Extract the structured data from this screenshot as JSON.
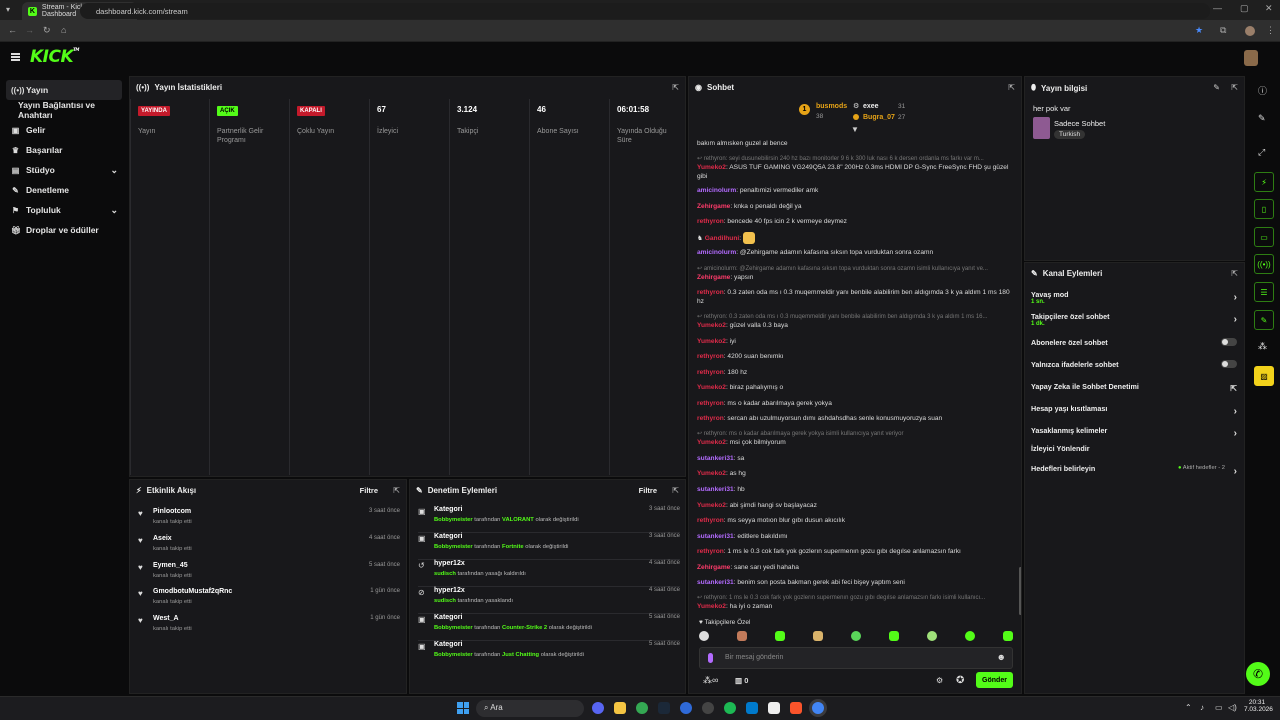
{
  "browser": {
    "tab_title": "Stream - Kick Dashboard",
    "url": "dashboard.kick.com/stream"
  },
  "app": {
    "logo": "KICK",
    "logo_tm": "TM"
  },
  "sidebar": {
    "items": [
      {
        "label": "Yayın",
        "icon": "broadcast-icon"
      },
      {
        "label": "Yayın Bağlantısı ve Anahtarı",
        "icon": ""
      },
      {
        "label": "Gelir",
        "icon": "wallet-icon"
      },
      {
        "label": "Başarılar",
        "icon": "trophy-icon"
      },
      {
        "label": "Stüdyo",
        "icon": "studio-icon"
      },
      {
        "label": "Denetleme",
        "icon": "wrench-icon"
      },
      {
        "label": "Topluluk",
        "icon": "community-icon"
      },
      {
        "label": "Droplar ve ödüller",
        "icon": "gift-icon"
      }
    ]
  },
  "stats": {
    "title": "Yayın İstatistikleri",
    "items": [
      {
        "badge": "YAYINDA",
        "badge_color": "#c41a2b",
        "label": "Yayın"
      },
      {
        "badge": "AÇIK",
        "badge_color": "#53fc18",
        "label": "Partnerlik Gelir Programı"
      },
      {
        "badge": "KAPALI",
        "badge_color": "#c41a2b",
        "label": "Çoklu Yayın"
      },
      {
        "value": "67",
        "label": "İzleyici"
      },
      {
        "value": "3.124",
        "label": "Takipçi"
      },
      {
        "value": "46",
        "label": "Abone Sayısı"
      },
      {
        "value": "06:01:58",
        "label": "Yayında Olduğu Süre"
      }
    ]
  },
  "chat": {
    "title": "Sohbet",
    "top": [
      {
        "name": "busmods",
        "count": "38"
      },
      {
        "name": "exee",
        "count": "31"
      },
      {
        "name": "Bugra_07",
        "count": "27"
      }
    ],
    "messages": [
      {
        "user": "",
        "text": "bakım almısken guzel al bence",
        "reply": ""
      },
      {
        "user": "Yumeko2",
        "text": "ASUS TUF GAMING VG249Q5A 23.8\" 200Hz 0.3ms HDMI DP G-Sync FreeSync FHD şu güzel gibi",
        "reply": "rethyron: seyi dusunebilirsin 240 hz bazı monitorler 9 6 k 300 luk nası 6 k dersen ordanla ms farkı var m..."
      },
      {
        "user": "amicinolurm",
        "text": "penaltımizi vermediler amk",
        "reply": ""
      },
      {
        "user": "Zehirgame",
        "text": "knka o penaldı değil ya",
        "reply": ""
      },
      {
        "user": "rethyron",
        "text": "bencede 40 fps icin 2 k vermeye deymez",
        "reply": ""
      },
      {
        "user": "Gandilhuni",
        "text": "",
        "reply": ""
      },
      {
        "user": "amicinolurm",
        "text": "@Zehirgame adamın kafasına sıksın topa vurduktan sonra ozamn",
        "reply": ""
      },
      {
        "user": "Zehirgame",
        "text": "yapsın",
        "reply": "amicinolurm: @Zehirgame adamın kafasına sıksın topa vurduktan sonra ozamn isimli kullanıcıya yanıt ve..."
      },
      {
        "user": "rethyron",
        "text": "0.3 zaten oda ms ı 0.3 muqemmeldir yanı benbile alabilirim ben aldıgımda 3 k ya aldım 1 ms 180 hz",
        "reply": ""
      },
      {
        "user": "Yumeko2",
        "text": "güzel valla 0.3 baya",
        "reply": "rethyron: 0.3 zaten oda ms ı 0.3 muqemmeldir yanı benbile alabilirim ben aldıgımda 3 k ya aldım 1 ms 16..."
      },
      {
        "user": "Yumeko2",
        "text": "iyi",
        "reply": ""
      },
      {
        "user": "rethyron",
        "text": "4200 suan benımkı",
        "reply": ""
      },
      {
        "user": "rethyron",
        "text": "180 hz",
        "reply": ""
      },
      {
        "user": "Yumeko2",
        "text": "biraz pahalıymış o",
        "reply": ""
      },
      {
        "user": "rethyron",
        "text": "ms o kadar abarılmaya gerek yokya",
        "reply": ""
      },
      {
        "user": "rethyron",
        "text": "sercan abı uzulmuyorsun dımı ashdahsdhas senle konusmuyoruzya suan",
        "reply": ""
      },
      {
        "user": "Yumeko2",
        "text": "msi çok bilmiyorum",
        "reply": "rethyron: ms o kadar abarılmaya gerek yokya isimli kullanıcıya yanıt veriyor"
      },
      {
        "user": "sutankeri31",
        "text": "sa",
        "reply": ""
      },
      {
        "user": "Yumeko2",
        "text": "as hg",
        "reply": ""
      },
      {
        "user": "sutankeri31",
        "text": "hb",
        "reply": ""
      },
      {
        "user": "Yumeko2",
        "text": "abi şimdi hangi sv başlayacaz",
        "reply": ""
      },
      {
        "user": "rethyron",
        "text": "ms seyya motıon blur gıbı dusun akıcılık",
        "reply": ""
      },
      {
        "user": "sutankeri31",
        "text": "editlere bakıldımı",
        "reply": ""
      },
      {
        "user": "rethyron",
        "text": "1 ms le 0.3 cok fark yok gozlerın supermenın gozu gıbı degılse anlamazsın farkı",
        "reply": ""
      },
      {
        "user": "Zehirgame",
        "text": "sane sarı yedi hahaha",
        "reply": ""
      },
      {
        "user": "sutankeri31",
        "text": "benim son posta bakman gerek abi feci bişey yaptım seni",
        "reply": ""
      },
      {
        "user": "Yumeko2",
        "text": "ha iyi o zaman",
        "reply": "rethyron: 1 ms le 0.3 cok fark yok gozlerın supermenın gozu gıbı degılse anlamazsın farkı isimli kullanıcı..."
      }
    ],
    "followers_only_label": "Takipçilere Özel",
    "input_placeholder": "Bir mesaj gönderin",
    "infinity": "∞",
    "zero": "0",
    "send_label": "Gönder"
  },
  "stream_info": {
    "title": "Yayın bilgisi",
    "stream_title": "her pok var",
    "category": "Sadece Sohbet",
    "language": "Turkish"
  },
  "channel_actions": {
    "title": "Kanal Eylemleri",
    "items": [
      {
        "label": "Yavaş mod",
        "sub": "1 sn.",
        "control": "chevron"
      },
      {
        "label": "Takipçilere özel sohbet",
        "sub": "1 dk.",
        "control": "chevron"
      },
      {
        "label": "Abonelere özel sohbet",
        "sub": "",
        "control": "toggle"
      },
      {
        "label": "Yalnızca ifadelerle sohbet",
        "sub": "",
        "control": "toggle"
      },
      {
        "label": "Yapay Zeka ile Sohbet Denetimi",
        "sub": "",
        "control": "external"
      },
      {
        "label": "Hesap yaşı kısıtlaması",
        "sub": "",
        "control": "chevron"
      },
      {
        "label": "Yasaklanmış kelimeler",
        "sub": "",
        "control": "chevron"
      },
      {
        "label": "İzleyici Yönlendir",
        "sub": "",
        "control": "none"
      },
      {
        "label": "Hedefleri belirleyin",
        "sub": "",
        "control": "chevron",
        "note": "Aktif hedefler - 2"
      }
    ]
  },
  "activity": {
    "title": "Etkinlik Akışı",
    "filter": "Filtre",
    "items": [
      {
        "name": "Pinlootcom",
        "sub": "kanalı takip etti",
        "time": "3 saat önce"
      },
      {
        "name": "Aseix",
        "sub": "kanalı takip etti",
        "time": "4 saat önce"
      },
      {
        "name": "Eymen_45",
        "sub": "kanalı takip etti",
        "time": "5 saat önce"
      },
      {
        "name": "GmodbotuMustaf2qRnc",
        "sub": "kanalı takip etti",
        "time": "1 gün önce"
      },
      {
        "name": "West_A",
        "sub": "kanalı takip etti",
        "time": "1 gün önce"
      }
    ]
  },
  "moderation": {
    "title": "Denetim Eylemleri",
    "filter": "Filtre",
    "items": [
      {
        "name": "Kategori",
        "actor": "Bobbymeister",
        "mid": "tarafından",
        "target": "VALORANT",
        "end": "olarak değiştirildi",
        "time": "3 saat önce",
        "icon": "category-icon"
      },
      {
        "name": "Kategori",
        "actor": "Bobbymeister",
        "mid": "tarafından",
        "target": "Fortnite",
        "end": "olarak değiştirildi",
        "time": "3 saat önce",
        "icon": "category-icon"
      },
      {
        "name": "hyper12x",
        "actor": "sudisch",
        "mid": "tarafından yasağı kaldırıldı",
        "target": "",
        "end": "",
        "time": "4 saat önce",
        "icon": "unban-icon"
      },
      {
        "name": "hyper12x",
        "actor": "sudisch",
        "mid": "tarafından yasaklandı",
        "target": "",
        "end": "",
        "time": "4 saat önce",
        "icon": "ban-icon"
      },
      {
        "name": "Kategori",
        "actor": "Bobbymeister",
        "mid": "tarafından",
        "target": "Counter-Strike 2",
        "end": "olarak değiştirildi",
        "time": "5 saat önce",
        "icon": "category-icon"
      },
      {
        "name": "Kategori",
        "actor": "Bobbymeister",
        "mid": "tarafından",
        "target": "Just Chatting",
        "end": "olarak değiştirildi",
        "time": "5 saat önce",
        "icon": "category-icon"
      }
    ]
  },
  "taskbar": {
    "search": "Ara",
    "time": "20:31",
    "date": "7.03.2026"
  },
  "colors": {
    "accent": "#53fc18",
    "live": "#c41a2b",
    "panel": "#18181b"
  }
}
